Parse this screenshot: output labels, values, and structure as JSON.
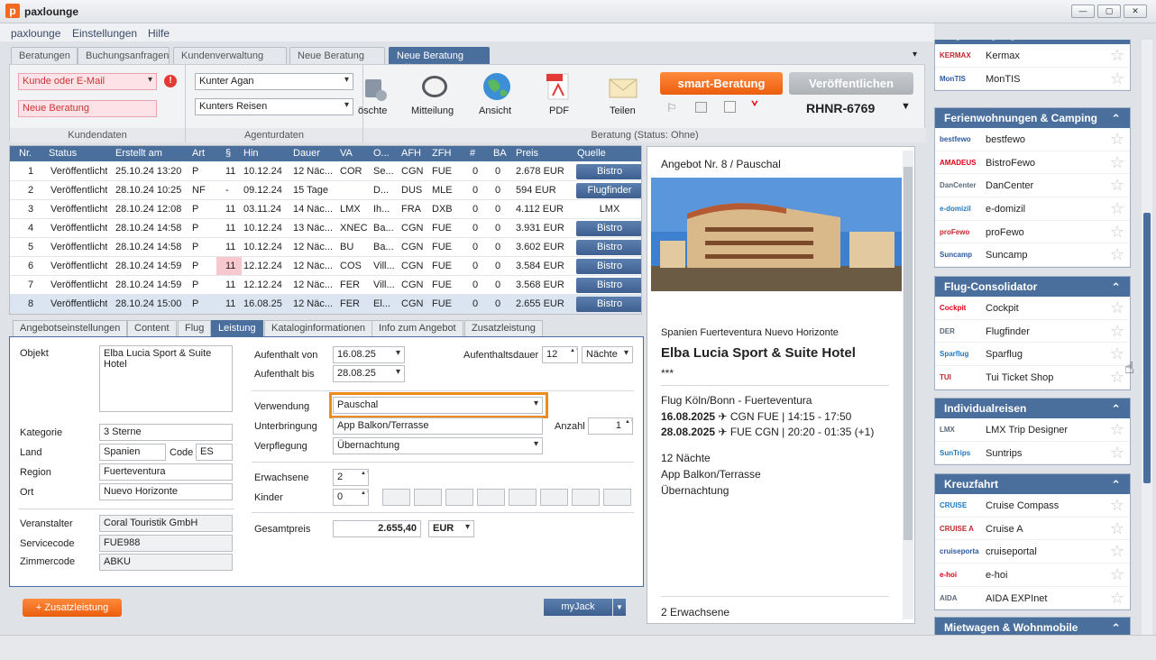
{
  "window": {
    "title": "paxlounge",
    "logo_letter": "p",
    "min": "—",
    "max": "▢",
    "close": "✕"
  },
  "menu": [
    "paxlounge",
    "Einstellungen",
    "Hilfe"
  ],
  "tabs": [
    {
      "label": "Beratungen"
    },
    {
      "label": "Buchungsanfragen"
    },
    {
      "label": "Kundenverwaltung"
    },
    {
      "label": "Neue Beratung"
    },
    {
      "label": "Neue Beratung",
      "active": true,
      "close": "✖"
    }
  ],
  "ribbon": {
    "kunde_placeholder": "Kunde oder E-Mail",
    "beratung_name": "Neue Beratung",
    "kundendaten_label": "Kundendaten",
    "agent": "Kunter Agan",
    "agentur": "Kunters Reisen",
    "agenturdaten_label": "Agenturdaten",
    "actions": [
      "öschte",
      "Mitteilung",
      "Ansicht",
      "PDF",
      "Teilen"
    ],
    "smart_label": "smart-Beratung",
    "publish_label": "Veröffentlichen",
    "code": "RHNR-6769",
    "status": "Beratung (Status: Ohne)",
    "warning": "!"
  },
  "grid": {
    "headers": [
      "Nr.",
      "Status",
      "Erstellt am",
      "Art",
      "§",
      "Hin",
      "Dauer",
      "VA",
      "O...",
      "AFH",
      "ZFH",
      "#",
      "BA",
      "Preis",
      "Quelle"
    ],
    "rows": [
      {
        "nr": "1",
        "status": "Veröffentlicht",
        "erstellt": "25.10.24 13:20",
        "art": "P",
        "par": "11",
        "hin": "10.12.24",
        "dauer": "12 Näc...",
        "va": "COR",
        "o": "Se...",
        "afh": "CGN",
        "zfh": "FUE",
        "n": "0",
        "ba": "0",
        "preis": "2.678 EUR",
        "quelle": "Bistro",
        "btn": true
      },
      {
        "nr": "2",
        "status": "Veröffentlicht",
        "erstellt": "28.10.24 10:25",
        "art": "NF",
        "par": "-",
        "hin": "09.12.24",
        "dauer": "15 Tage",
        "va": "",
        "o": "D...",
        "afh": "DUS",
        "zfh": "MLE",
        "n": "0",
        "ba": "0",
        "preis": "594 EUR",
        "quelle": "Flugfinder",
        "btn": true
      },
      {
        "nr": "3",
        "status": "Veröffentlicht",
        "erstellt": "28.10.24 12:08",
        "art": "P",
        "par": "11",
        "hin": "03.11.24",
        "dauer": "14 Näc...",
        "va": "LMX",
        "o": "Ih...",
        "afh": "FRA",
        "zfh": "DXB",
        "n": "0",
        "ba": "0",
        "preis": "4.112 EUR",
        "quelle": "LMX",
        "btn": false
      },
      {
        "nr": "4",
        "status": "Veröffentlicht",
        "erstellt": "28.10.24 14:58",
        "art": "P",
        "par": "11",
        "hin": "10.12.24",
        "dauer": "13 Näc...",
        "va": "XNEC",
        "o": "Ba...",
        "afh": "CGN",
        "zfh": "FUE",
        "n": "0",
        "ba": "0",
        "preis": "3.931 EUR",
        "quelle": "Bistro",
        "btn": true
      },
      {
        "nr": "5",
        "status": "Veröffentlicht",
        "erstellt": "28.10.24 14:58",
        "art": "P",
        "par": "11",
        "hin": "10.12.24",
        "dauer": "12 Näc...",
        "va": "BU",
        "o": "Ba...",
        "afh": "CGN",
        "zfh": "FUE",
        "n": "0",
        "ba": "0",
        "preis": "3.602 EUR",
        "quelle": "Bistro",
        "btn": true
      },
      {
        "nr": "6",
        "status": "Veröffentlicht",
        "erstellt": "28.10.24 14:59",
        "art": "P",
        "par": "11",
        "hin": "12.12.24",
        "dauer": "12 Näc...",
        "va": "COS",
        "o": "Vill...",
        "afh": "CGN",
        "zfh": "FUE",
        "n": "0",
        "ba": "0",
        "preis": "3.584 EUR",
        "quelle": "Bistro",
        "btn": true,
        "pink": true
      },
      {
        "nr": "7",
        "status": "Veröffentlicht",
        "erstellt": "28.10.24 14:59",
        "art": "P",
        "par": "11",
        "hin": "12.12.24",
        "dauer": "12 Näc...",
        "va": "FER",
        "o": "Vill...",
        "afh": "CGN",
        "zfh": "FUE",
        "n": "0",
        "ba": "0",
        "preis": "3.568 EUR",
        "quelle": "Bistro",
        "btn": true
      },
      {
        "nr": "8",
        "status": "Veröffentlicht",
        "erstellt": "28.10.24 15:00",
        "art": "P",
        "par": "11",
        "hin": "16.08.25",
        "dauer": "12 Näc...",
        "va": "FER",
        "o": "El...",
        "afh": "CGN",
        "zfh": "FUE",
        "n": "0",
        "ba": "0",
        "preis": "2.655 EUR",
        "quelle": "Bistro",
        "btn": true,
        "selected": true
      }
    ]
  },
  "subtabs": [
    "Angebotseinstellungen",
    "Content",
    "Flug",
    "Leistung",
    "Kataloginformationen",
    "Info zum Angebot",
    "Zusatzleistung"
  ],
  "form": {
    "objekt_label": "Objekt",
    "objekt": "Elba Lucia Sport & Suite Hotel",
    "kategorie_label": "Kategorie",
    "kategorie": "3 Sterne",
    "land_label": "Land",
    "land": "Spanien",
    "code_label": "Code",
    "code": "ES",
    "region_label": "Region",
    "region": "Fuerteventura",
    "ort_label": "Ort",
    "ort": "Nuevo Horizonte",
    "veranstalter_label": "Veranstalter",
    "veranstalter": "Coral Touristik GmbH",
    "servicecode_label": "Servicecode",
    "servicecode": "FUE988",
    "zimmercode_label": "Zimmercode",
    "zimmercode": "ABKU",
    "von_label": "Aufenthalt von",
    "von": "16.08.25",
    "bis_label": "Aufenthalt bis",
    "bis": "28.08.25",
    "dauer_label": "Aufenthaltsdauer",
    "dauer": "12",
    "dauer_unit": "Nächte",
    "verwendung_label": "Verwendung",
    "verwendung": "Pauschal",
    "unterbringung_label": "Unterbringung",
    "unterbringung": "App Balkon/Terrasse",
    "anzahl_label": "Anzahl",
    "anzahl": "1",
    "verpflegung_label": "Verpflegung",
    "verpflegung": "Übernachtung",
    "erwachsene_label": "Erwachsene",
    "erwachsene": "2",
    "kinder_label": "Kinder",
    "kinder": "0",
    "gesamtpreis_label": "Gesamtpreis",
    "gesamtpreis": "2.655,40",
    "currency": "EUR"
  },
  "bottom": {
    "zusatz": "+ Zusatzleistung",
    "myjack": "myJack"
  },
  "offer": {
    "heading": "Angebot Nr. 8 / Pauschal",
    "location": "Spanien Fuerteventura Nuevo Horizonte",
    "hotel": "Elba Lucia Sport & Suite Hotel",
    "stars": "***",
    "flight": "Flug Köln/Bonn - Fuerteventura",
    "out_date": "16.08.2025",
    "out_rest": "CGN FUE | 14:15 - 17:50",
    "ret_date": "28.08.2025",
    "ret_rest": "FUE CGN | 20:20 - 01:35 (+1)",
    "nights": "12 Nächte",
    "room": "App Balkon/Terrasse",
    "board": "Übernachtung",
    "persons": "2 Erwachsene"
  },
  "categories": [
    {
      "title": "Digital Signage",
      "items": [
        {
          "logo": "KERMAX",
          "name": "Kermax"
        },
        {
          "logo": "MonTIS",
          "name": "MonTIS"
        }
      ]
    },
    {
      "title": "Ferienwohnungen & Camping",
      "items": [
        {
          "logo": "bestfewo",
          "name": "bestfewo"
        },
        {
          "logo": "AMADEUS",
          "name": "BistroFewo"
        },
        {
          "logo": "DanCenter",
          "name": "DanCenter"
        },
        {
          "logo": "e-domizil",
          "name": "e-domizil"
        },
        {
          "logo": "proFewo",
          "name": "proFewo"
        },
        {
          "logo": "Suncamp",
          "name": "Suncamp"
        }
      ]
    },
    {
      "title": "Flug-Consolidator",
      "items": [
        {
          "logo": "Cockpit",
          "name": "Cockpit"
        },
        {
          "logo": "DER",
          "name": "Flugfinder"
        },
        {
          "logo": "Sparflug",
          "name": "Sparflug"
        },
        {
          "logo": "TUI",
          "name": "Tui Ticket Shop"
        }
      ]
    },
    {
      "title": "Individualreisen",
      "items": [
        {
          "logo": "LMX",
          "name": "LMX Trip Designer"
        },
        {
          "logo": "SunTrips",
          "name": "Suntrips"
        }
      ]
    },
    {
      "title": "Kreuzfahrt",
      "items": [
        {
          "logo": "CRUISE",
          "name": "Cruise Compass"
        },
        {
          "logo": "CRUISE A",
          "name": "Cruise A"
        },
        {
          "logo": "cruiseportal",
          "name": "cruiseportal"
        },
        {
          "logo": "e-hoi",
          "name": "e-hoi"
        },
        {
          "logo": "AIDA",
          "name": "AIDA EXPInet"
        }
      ]
    },
    {
      "title": "Mietwagen & Wohnmobile",
      "items": []
    }
  ]
}
